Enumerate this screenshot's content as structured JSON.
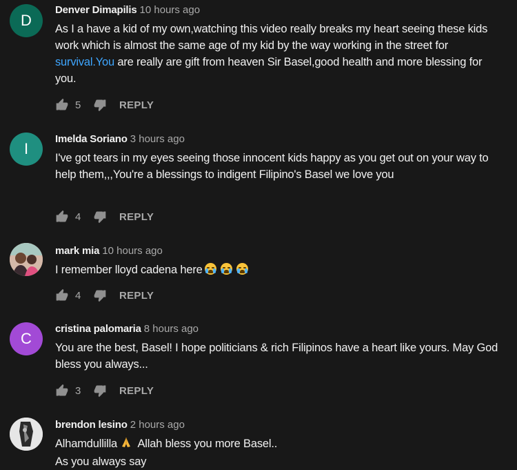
{
  "colors": {
    "background": "#181818",
    "link": "#3ea6ff",
    "avatar_d": "#0b6a56",
    "avatar_i": "#1f8f80",
    "avatar_c": "#a24ad6"
  },
  "reply_label": "REPLY",
  "comments": [
    {
      "author": "Denver Dimapilis",
      "time": "10 hours ago",
      "avatar_letter": "D",
      "text_before": "As I a have a kid of my own,watching this video really breaks my heart seeing these kids work which is almost the same age of my kid by the way working in the street for ",
      "text_link": "survival.You",
      "text_after": " are really are gift from heaven Sir Basel,good health and more blessing for you.",
      "likes": "5"
    },
    {
      "author": "Imelda Soriano",
      "time": "3 hours ago",
      "avatar_letter": "I",
      "text": "I've got tears in my eyes seeing those innocent kids happy as you get out on your way to help them,,,You're a blessings to indigent Filipino's Basel we love you",
      "likes": "4"
    },
    {
      "author": "mark mia",
      "time": "10 hours ago",
      "avatar_letter": "",
      "text": "I remember lloyd cadena here",
      "likes": "4"
    },
    {
      "author": "cristina palomaria",
      "time": "8 hours ago",
      "avatar_letter": "C",
      "text": "You are the best, Basel! I hope politicians  & rich Filipinos have a heart like yours. May God bless you always...",
      "likes": "3"
    },
    {
      "author": "brendon lesino",
      "time": "2 hours ago",
      "avatar_letter": "",
      "text_line1_before": "Alhamdullilla",
      "text_line1_after": " Allah bless you more Basel..",
      "text_line2": "As you always say"
    }
  ]
}
